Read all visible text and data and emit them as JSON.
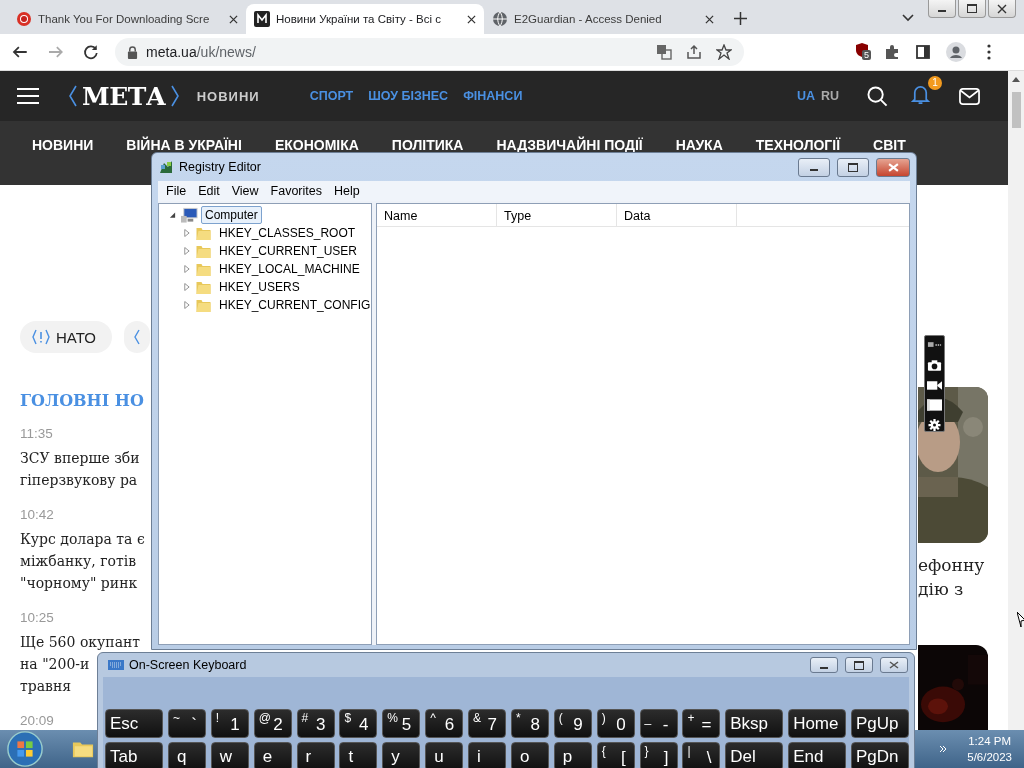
{
  "browser": {
    "tabs": [
      {
        "title": "Thank You For Downloading Scre",
        "selected": false
      },
      {
        "title": "Новини України та Світу - Всі с",
        "selected": true
      },
      {
        "title": "E2Guardian - Access Denied",
        "selected": false
      }
    ],
    "address": {
      "host": "meta.ua",
      "path": "/uk/news/"
    },
    "extension_badge": "5"
  },
  "site": {
    "logo": "МЕТА",
    "section": "НОВИНИ",
    "links": [
      "СПОРТ",
      "ШОУ БІЗНЕС",
      "ФІНАНСИ"
    ],
    "languages": [
      {
        "label": "UA",
        "selected": true
      },
      {
        "label": "RU",
        "selected": false
      }
    ],
    "notification_count": "1",
    "nav": [
      "НОВИНИ",
      "ВІЙНА В УКРАЇНІ",
      "ЕКОНОМІКА",
      "ПОЛІТИКА",
      "НАДЗВИЧАЙНІ ПОДІЇ",
      "НАУКА",
      "ТЕХНОЛОГІЇ",
      "СВІТ"
    ],
    "tags": [
      "НАТО"
    ],
    "heading": "ГОЛОВНІ НО",
    "news": [
      {
        "time": "11:35",
        "lines": [
          "ЗСУ вперше зби",
          "гіперзвукову ра"
        ]
      },
      {
        "time": "10:42",
        "lines": [
          "Курс долара та є",
          "міжбанку, готів",
          "\"чорному\" ринк"
        ]
      },
      {
        "time": "10:25",
        "lines": [
          "Ще 560 окупант",
          "на \"200-и",
          "травня"
        ]
      },
      {
        "time": "20:09"
      }
    ],
    "side_story": [
      "ефонну",
      "дію з"
    ]
  },
  "registry_editor": {
    "title": "Registry Editor",
    "menu": [
      "File",
      "Edit",
      "View",
      "Favorites",
      "Help"
    ],
    "tree": {
      "label": "Computer",
      "selected": true,
      "expanded": true,
      "children": [
        {
          "label": "HKEY_CLASSES_ROOT",
          "expanded": false
        },
        {
          "label": "HKEY_CURRENT_USER",
          "expanded": false
        },
        {
          "label": "HKEY_LOCAL_MACHINE",
          "expanded": false
        },
        {
          "label": "HKEY_USERS",
          "expanded": false
        },
        {
          "label": "HKEY_CURRENT_CONFIG",
          "expanded": false
        }
      ]
    },
    "columns": [
      "Name",
      "Type",
      "Data"
    ]
  },
  "keyboard": {
    "title": "On-Screen Keyboard",
    "rows": [
      [
        {
          "kind": "wide",
          "label": "Esc"
        },
        {
          "kind": "dual",
          "shift": "~",
          "main": "`"
        },
        {
          "kind": "dual",
          "shift": "!",
          "main": "1"
        },
        {
          "kind": "dual",
          "shift": "@",
          "main": "2"
        },
        {
          "kind": "dual",
          "shift": "#",
          "main": "3"
        },
        {
          "kind": "dual",
          "shift": "$",
          "main": "4"
        },
        {
          "kind": "dual",
          "shift": "%",
          "main": "5"
        },
        {
          "kind": "dual",
          "shift": "^",
          "main": "6"
        },
        {
          "kind": "dual",
          "shift": "&",
          "main": "7"
        },
        {
          "kind": "dual",
          "shift": "*",
          "main": "8"
        },
        {
          "kind": "dual",
          "shift": "(",
          "main": "9"
        },
        {
          "kind": "dual",
          "shift": ")",
          "main": "0"
        },
        {
          "kind": "dual",
          "shift": "_",
          "main": "-"
        },
        {
          "kind": "dual",
          "shift": "+",
          "main": "="
        },
        {
          "kind": "wide",
          "label": "Bksp"
        },
        {
          "kind": "wide",
          "label": "Home"
        },
        {
          "kind": "wide",
          "label": "PgUp"
        }
      ],
      [
        {
          "kind": "wide",
          "label": "Tab"
        },
        {
          "kind": "letter",
          "label": "q"
        },
        {
          "kind": "letter",
          "label": "w"
        },
        {
          "kind": "letter",
          "label": "e"
        },
        {
          "kind": "letter",
          "label": "r"
        },
        {
          "kind": "letter",
          "label": "t"
        },
        {
          "kind": "letter",
          "label": "y"
        },
        {
          "kind": "letter",
          "label": "u"
        },
        {
          "kind": "letter",
          "label": "i"
        },
        {
          "kind": "letter",
          "label": "o"
        },
        {
          "kind": "letter",
          "label": "p"
        },
        {
          "kind": "dual",
          "shift": "{",
          "main": "["
        },
        {
          "kind": "dual",
          "shift": "}",
          "main": "]"
        },
        {
          "kind": "dual",
          "shift": "|",
          "main": "\\"
        },
        {
          "kind": "wide",
          "label": "Del"
        },
        {
          "kind": "wide",
          "label": "End"
        },
        {
          "kind": "wide",
          "label": "PgDn"
        }
      ]
    ]
  },
  "taskbar": {
    "time": "1:24 PM",
    "date": "5/6/2023"
  }
}
